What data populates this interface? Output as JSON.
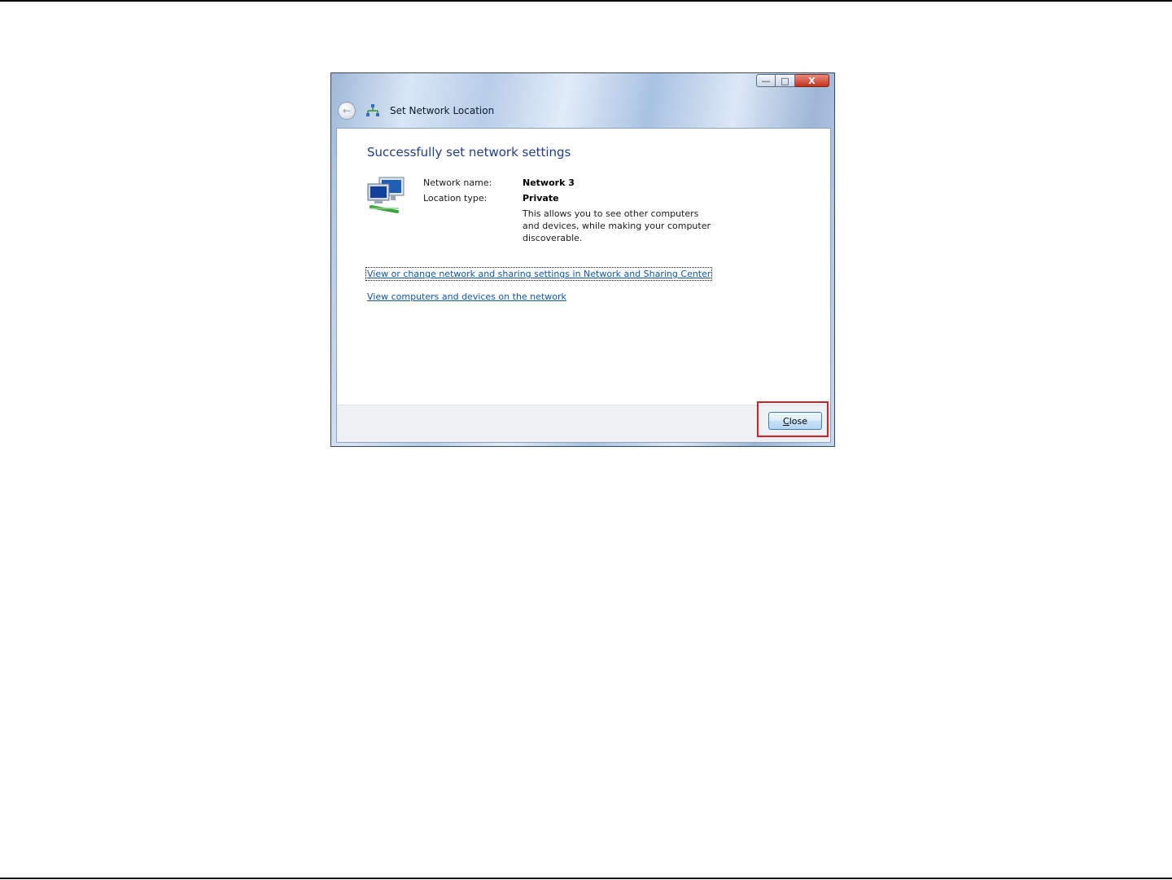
{
  "window": {
    "title": "Set Network Location",
    "controls": {
      "minimize": "—",
      "maximize": "□",
      "close": "X"
    },
    "back_arrow": "←"
  },
  "dialog": {
    "heading": "Successfully set network settings",
    "network_name_label": "Network name:",
    "network_name_value": "Network  3",
    "location_type_label": "Location type:",
    "location_type_value": "Private",
    "description": "This allows you to see other computers and devices, while making your computer discoverable.",
    "links": [
      "View or change network and sharing settings in Network and Sharing Center",
      "View computers and devices on the network"
    ]
  },
  "footer": {
    "close_mnemonic": "C",
    "close_rest": "lose"
  },
  "colors": {
    "heading": "#1e3d8f",
    "link": "#1155aa",
    "highlight": "#d81e25"
  },
  "icons": [
    "back-arrow-icon",
    "network-icon",
    "computer-network-icon"
  ]
}
